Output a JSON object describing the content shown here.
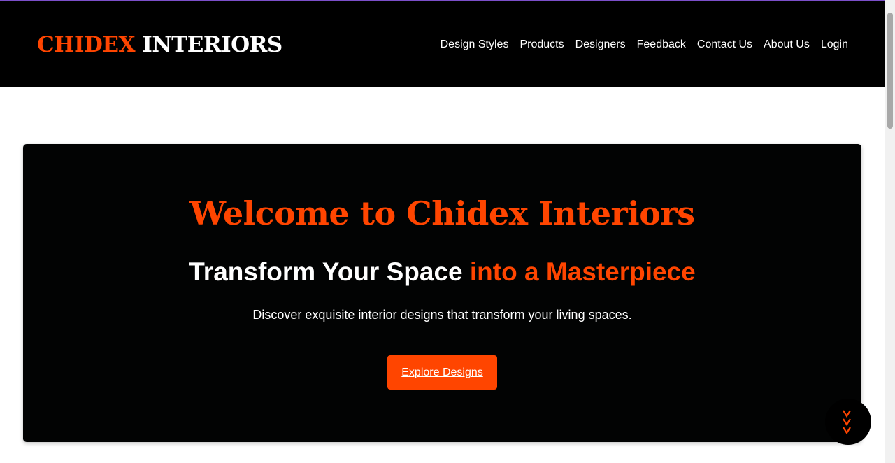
{
  "header": {
    "brand": "CHIDEX",
    "brand_suffix": "INTERIORS",
    "nav": [
      "Design Styles",
      "Products",
      "Designers",
      "Feedback",
      "Contact Us",
      "About Us",
      "Login"
    ]
  },
  "hero": {
    "title": "Welcome to Chidex Interiors",
    "subtitle_part1": "Transform Your Space",
    "subtitle_part2": "into a Masterpiece",
    "description": "Discover exquisite interior designs that transform your living spaces.",
    "cta_label": "Explore Designs"
  },
  "floating": {
    "icon": "triple-chevron-down-icon"
  },
  "colors": {
    "accent": "#ff4500",
    "header_bg": "#000000",
    "hero_bg": "#020303",
    "top_border": "#7b4fc9"
  }
}
